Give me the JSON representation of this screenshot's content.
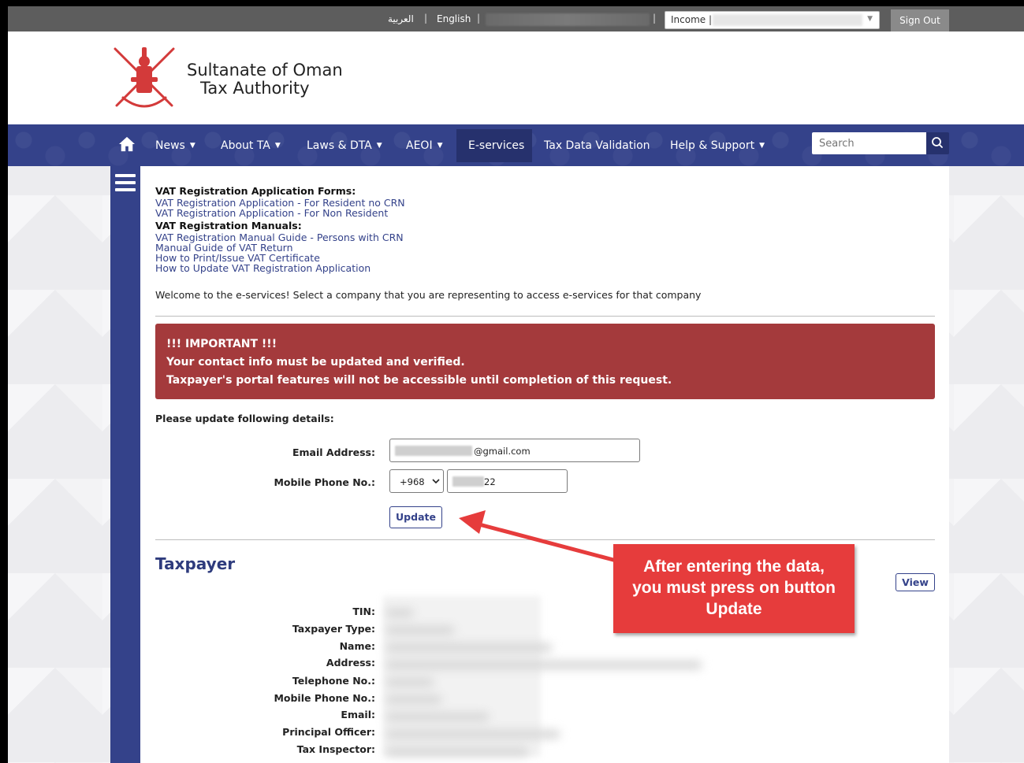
{
  "topbar": {
    "lang_arabic": "العربية",
    "lang_english": "English",
    "separator": "|",
    "company_select_value": "Income |",
    "sign_out": "Sign Out"
  },
  "header": {
    "brand_line1": "Sultanate of Oman",
    "brand_line2": "Tax Authority"
  },
  "nav": {
    "items": [
      {
        "label": "News",
        "dropdown": true
      },
      {
        "label": "About TA",
        "dropdown": true
      },
      {
        "label": "Laws & DTA",
        "dropdown": true
      },
      {
        "label": "AEOI",
        "dropdown": true
      },
      {
        "label": "E-services",
        "dropdown": false,
        "active": true
      },
      {
        "label": "Tax Data Validation",
        "dropdown": false
      },
      {
        "label": "Help & Support",
        "dropdown": true
      }
    ],
    "search_placeholder": "Search"
  },
  "content": {
    "vat_forms_title": "VAT Registration Application Forms:",
    "vat_forms_links": [
      "VAT Registration Application - For Resident no CRN",
      "VAT Registration Application - For Non Resident"
    ],
    "vat_manuals_title": "VAT Registration Manuals:",
    "vat_manuals_links": [
      "VAT Registration Manual Guide - Persons with CRN",
      "Manual Guide of VAT Return",
      "How to Print/Issue VAT Certificate",
      "How to Update VAT Registration Application"
    ],
    "welcome": "Welcome to the e-services! Select a company that you are representing to access e-services for that company",
    "alert": {
      "line1": "!!! IMPORTANT !!!",
      "line2": "Your contact info must be updated and verified.",
      "line3": "Taxpayer's portal features will not be accessible until completion of this request."
    },
    "please_update": "Please update following details:",
    "email_label": "Email Address:",
    "email_suffix": "@gmail.com",
    "mobile_label": "Mobile Phone No.:",
    "country_code": "+968",
    "mobile_suffix": "22",
    "update_button": "Update",
    "taxpayer_title": "Taxpayer",
    "view_button": "View",
    "taxpayer_fields": [
      "TIN:",
      "Taxpayer Type:",
      "Name:",
      "Address:",
      "Telephone No.:",
      "Mobile Phone No.:",
      "Email:",
      "Principal Officer:",
      "Tax Inspector:"
    ]
  },
  "annotation": {
    "line1": "After entering the data,",
    "line2": "you must press on button",
    "line3": "Update"
  },
  "colors": {
    "nav_blue": "#34428a",
    "nav_active": "#26316d",
    "alert_red": "#a43a3c",
    "callout_red": "#e63c3c"
  }
}
